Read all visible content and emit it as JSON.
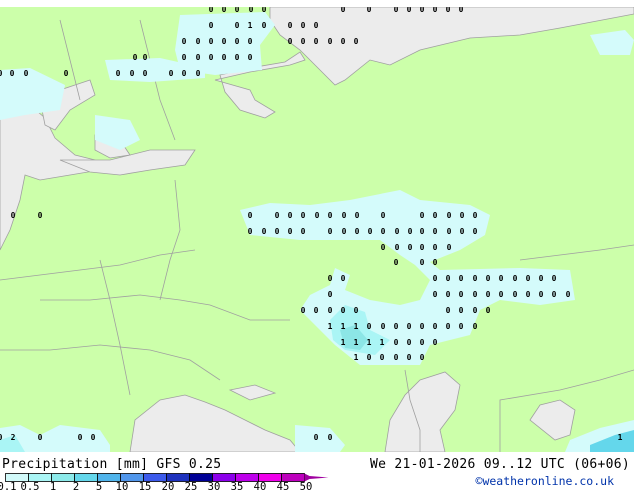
{
  "legend": {
    "title": "Precipitation [mm]  GFS 0.25",
    "ticks": [
      "0.1",
      "0.5",
      "1",
      "2",
      "5",
      "10",
      "15",
      "20",
      "25",
      "30",
      "35",
      "40",
      "45",
      "50"
    ],
    "colors": [
      "#d2fafa",
      "#aaf5f5",
      "#8ceaea",
      "#64d7eb",
      "#50b4eb",
      "#5096eb",
      "#3c5aeb",
      "#1e32be",
      "#000096",
      "#8c00eb",
      "#be00eb",
      "#f000eb",
      "#be00be"
    ],
    "arrow_color": "#a000a0"
  },
  "valid_time": "We 21-01-2026 09..12 UTC (06+06)",
  "copyright": "©weatheronline.co.uk",
  "map_colors": {
    "land": "#ccffaa",
    "sea": "#ececec",
    "border": "#a0a0a0",
    "precip_light": "#d4fbfb",
    "precip_mid": "#aaf5f5",
    "precip_high": "#8ce6e6"
  },
  "markers": [
    "0",
    "0",
    "0",
    "0",
    "0",
    "0",
    "0",
    "0",
    "0",
    "0",
    "0",
    "0",
    "0",
    "0",
    "0",
    "1",
    "0",
    "0",
    "0",
    "0",
    "0",
    "0",
    "0",
    "0",
    "0",
    "0",
    "0",
    "0",
    "0",
    "0",
    "0",
    "0",
    "0",
    "0",
    "0",
    "0",
    "0",
    "0",
    "0",
    "0",
    "0",
    "0",
    "0",
    "0",
    "0",
    "0",
    "0",
    "0",
    "0",
    "0",
    "0",
    "0",
    "0",
    "0",
    "0",
    "0",
    "0",
    "0",
    "0",
    "0",
    "0",
    "0",
    "0",
    "0",
    "0",
    "0",
    "0",
    "0",
    "0",
    "0",
    "0",
    "0",
    "0",
    "0",
    "0",
    "0",
    "0",
    "0",
    "0",
    "0",
    "0",
    "0",
    "0",
    "0",
    "0",
    "0",
    "0",
    "0",
    "0",
    "0",
    "0",
    "0",
    "0",
    "0",
    "0",
    "0",
    "0",
    "0",
    "0",
    "0",
    "0",
    "0",
    "0",
    "0",
    "0",
    "0",
    "0",
    "0",
    "0",
    "0",
    "0",
    "0",
    "0",
    "0",
    "0",
    "0",
    "0",
    "0",
    "0",
    "0",
    "0",
    "0",
    "0",
    "0",
    "0",
    "1",
    "1",
    "1",
    "0",
    "0",
    "0",
    "0",
    "0",
    "0",
    "0",
    "0",
    "0",
    "1",
    "1",
    "1",
    "1",
    "0",
    "0",
    "0",
    "0",
    "1",
    "0",
    "0",
    "0",
    "0",
    "0",
    "0",
    "2",
    "0",
    "0",
    "0",
    "0",
    "0",
    "1"
  ]
}
